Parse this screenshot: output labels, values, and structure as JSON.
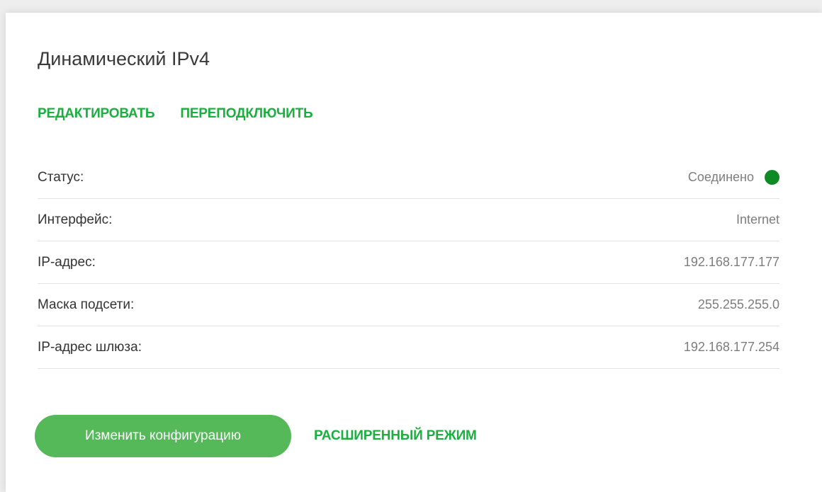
{
  "header": {
    "title": "Динамический IPv4"
  },
  "actions": {
    "edit_label": "РЕДАКТИРОВАТЬ",
    "reconnect_label": "ПЕРЕПОДКЛЮЧИТЬ"
  },
  "info": {
    "rows": [
      {
        "label": "Статус:",
        "value": "Соединено"
      },
      {
        "label": "Интерфейс:",
        "value": "Internet"
      },
      {
        "label": "IP-адрес:",
        "value": "192.168.177.177"
      },
      {
        "label": "Маска подсети:",
        "value": "255.255.255.0"
      },
      {
        "label": "IP-адрес шлюза:",
        "value": "192.168.177.254"
      }
    ],
    "status_color": "#0e8a24"
  },
  "footer": {
    "change_config_label": "Изменить конфигурацию",
    "advanced_mode_label": "РАСШИРЕННЫЙ РЕЖИМ"
  },
  "colors": {
    "accent": "#1aaf3e",
    "button": "#55b95a"
  }
}
